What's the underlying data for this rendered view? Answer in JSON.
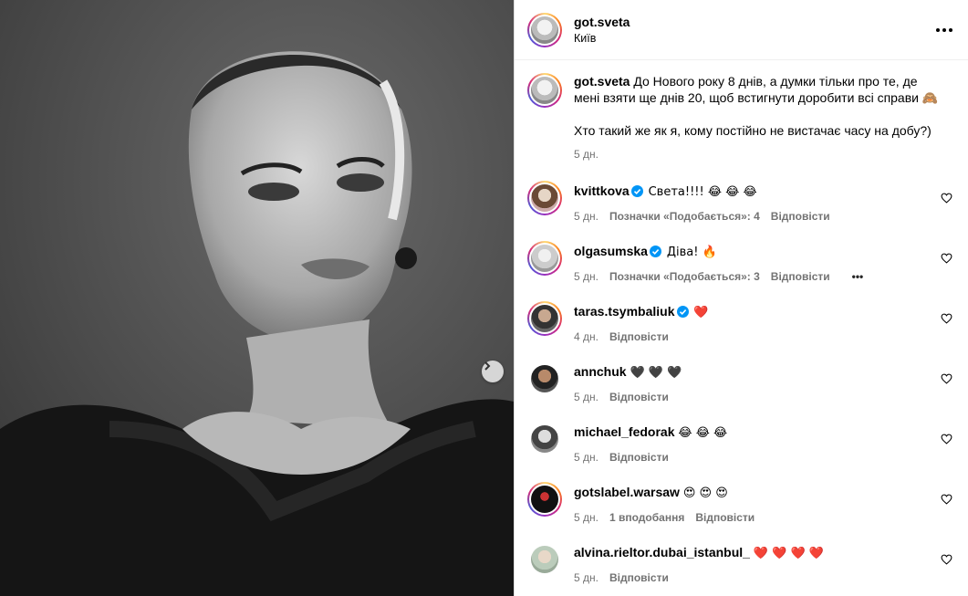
{
  "post": {
    "author": "got.sveta",
    "location": "Київ",
    "caption_line1": "До Нового року 8 днів, а думки тільки про те, де мені взяти ще днів 20, щоб встигнути доробити всі справи 🙈",
    "caption_line2": "Хто такий же як я, кому постійно не вистачає часу на добу?)",
    "caption_time": "5 дн."
  },
  "icons": {
    "more": "more-horizontal-icon",
    "next": "chevron-right-icon",
    "heart": "heart-outline-icon",
    "verified": "verified-badge-icon"
  },
  "colors": {
    "verified": "#0095f6",
    "meta": "#737373",
    "red_heart": "#e0245e"
  },
  "comments": [
    {
      "user": "kvittkova",
      "verified": true,
      "text": "Света!!!! 😂 😂 😂",
      "time": "5 дн.",
      "likes": "Позначки «Подобається»: 4",
      "reply": "Відповісти"
    },
    {
      "user": "olgasumska",
      "verified": true,
      "text": "Діва! 🔥",
      "time": "5 дн.",
      "likes": "Позначки «Подобається»: 3",
      "reply": "Відповісти",
      "more": "•••"
    },
    {
      "user": "taras.tsymbaliuk",
      "verified": true,
      "text": "❤️",
      "time": "4 дн.",
      "reply": "Відповісти"
    },
    {
      "user": "annchuk",
      "verified": false,
      "text": "🖤 🖤 🖤",
      "time": "5 дн.",
      "reply": "Відповісти"
    },
    {
      "user": "michael_fedorak",
      "verified": false,
      "text": "😂 😂 😂",
      "time": "5 дн.",
      "reply": "Відповісти"
    },
    {
      "user": "gotslabel.warsaw",
      "verified": false,
      "text": "😍 😍 😍",
      "time": "5 дн.",
      "likes": "1 вподобання",
      "reply": "Відповісти"
    },
    {
      "user": "alvina.rieltor.dubai_istanbul_",
      "verified": false,
      "text": "❤️ ❤️ ❤️ ❤️",
      "time": "5 дн.",
      "reply": "Відповісти"
    }
  ]
}
